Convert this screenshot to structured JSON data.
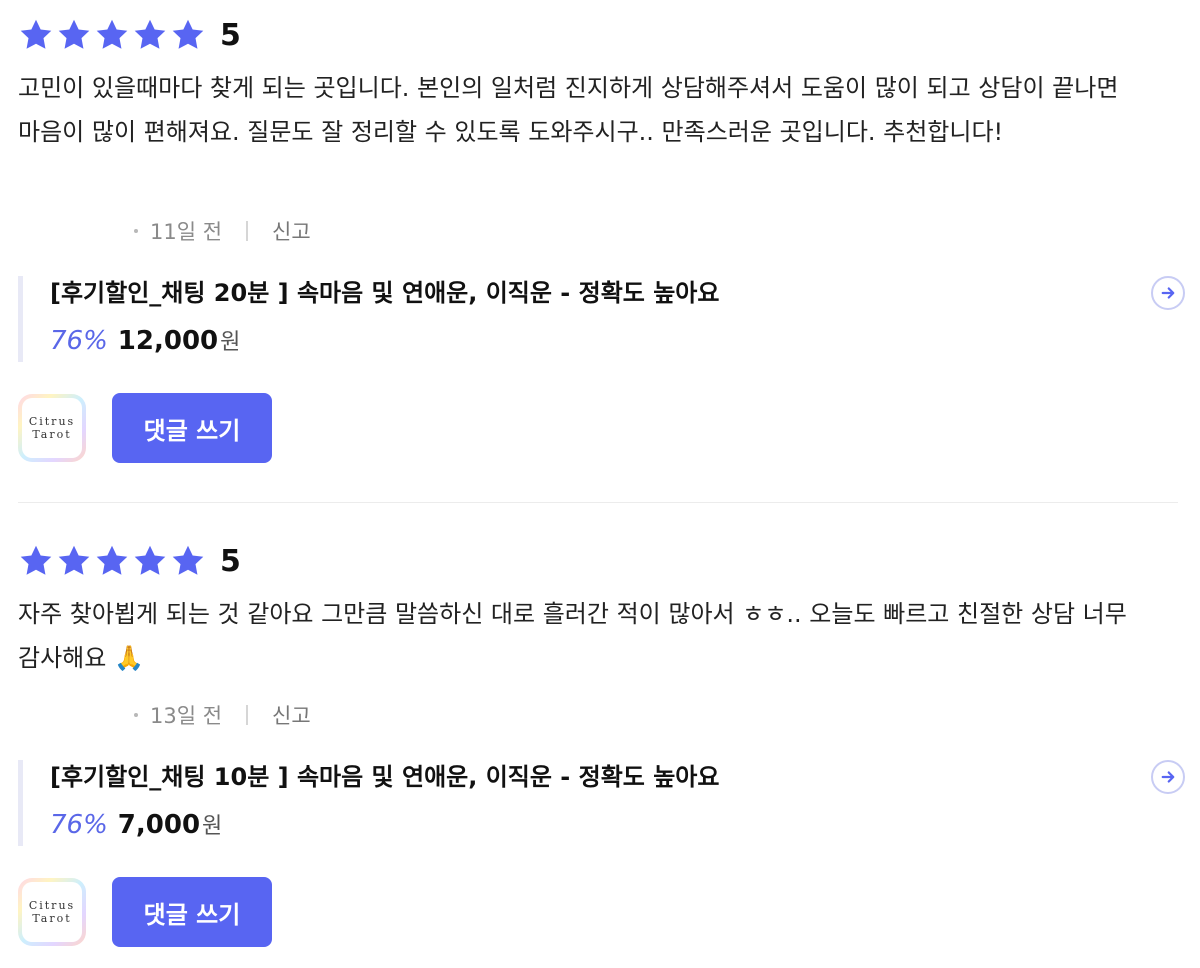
{
  "colors": {
    "star": "#5865f2",
    "accent": "#5a67e8",
    "button_bg": "#5865f2",
    "product_border": "#e8e9f6"
  },
  "reviews": [
    {
      "rating": 5,
      "score_label": "5",
      "content": "고민이 있을때마다 찾게 되는 곳입니다. 본인의 일처럼 진지하게 상담해주셔서 도움이 많이 되고 상담이 끝나면 마음이 많이 편해져요. 질문도 잘 정리할 수 있도록 도와주시구.. 만족스러운 곳입니다. 추천합니다!",
      "time_ago": "11일 전",
      "report_label": "신고",
      "product": {
        "title": "[후기할인_채팅 20분 ] 속마음 및 연애운, 이직운 - 정확도 높아요",
        "discount": "76%",
        "price": "12,000",
        "currency": "원"
      },
      "logo": {
        "line1": "Citrus",
        "line2": "Tarot"
      },
      "comment_label": "댓글 쓰기"
    },
    {
      "rating": 5,
      "score_label": "5",
      "content": "자주 찾아뵙게 되는 것 같아요 그만큼 말씀하신 대로 흘러간 적이 많아서 ㅎㅎ.. 오늘도 빠르고 친절한 상담 너무 감사해요 🙏",
      "time_ago": "13일 전",
      "report_label": "신고",
      "product": {
        "title": "[후기할인_채팅 10분 ] 속마음 및 연애운, 이직운 - 정확도 높아요",
        "discount": "76%",
        "price": "7,000",
        "currency": "원"
      },
      "logo": {
        "line1": "Citrus",
        "line2": "Tarot"
      },
      "comment_label": "댓글 쓰기"
    }
  ],
  "icons": {
    "star": "star-icon",
    "arrow": "arrow-right-circle-icon"
  }
}
